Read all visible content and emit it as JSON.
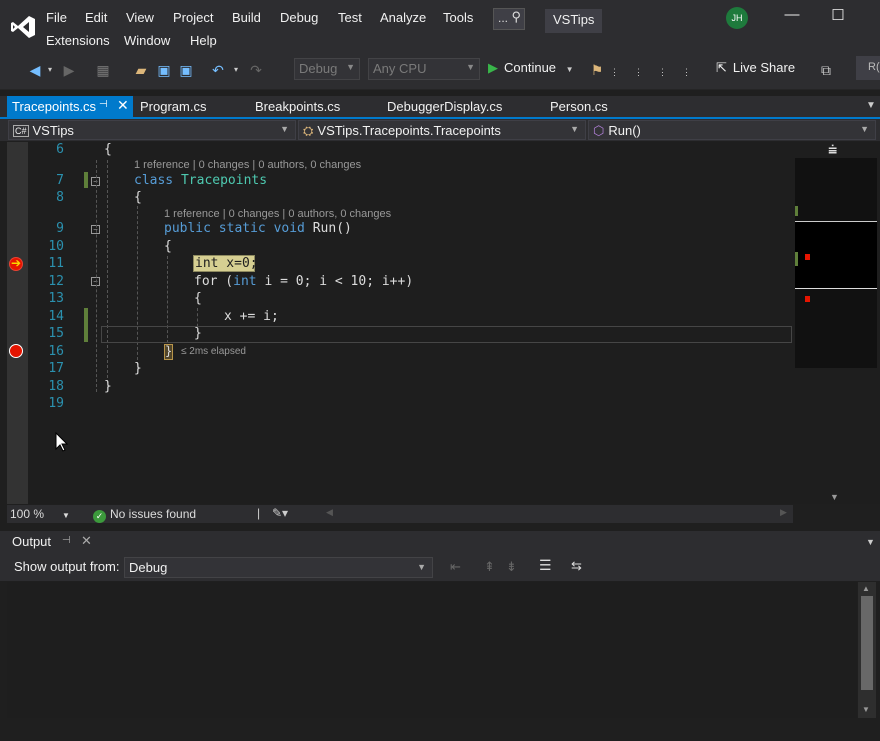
{
  "menu": {
    "row1": [
      "File",
      "Edit",
      "View",
      "Project",
      "Build",
      "Debug",
      "Test",
      "Analyze",
      "Tools"
    ],
    "row2": [
      "Extensions",
      "Window",
      "Help"
    ],
    "search_placeholder": "...",
    "solution_name": "VSTips",
    "user_initials": "JH"
  },
  "toolbar": {
    "config": "Debug",
    "platform": "Any CPU",
    "continue_label": "Continue",
    "live_share_label": "Live Share",
    "r_label": "R("
  },
  "tabs": [
    "Tracepoints.cs",
    "Program.cs",
    "Breakpoints.cs",
    "DebuggerDisplay.cs",
    "Person.cs"
  ],
  "navbar": {
    "project": "VSTips",
    "type": "VSTips.Tracepoints.Tracepoints",
    "member": "Run()"
  },
  "editor": {
    "line_numbers": [
      "6",
      "7",
      "8",
      "9",
      "10",
      "11",
      "12",
      "13",
      "14",
      "15",
      "16",
      "17",
      "18",
      "19"
    ],
    "lens_class": "1 reference | 0 changes | 0 authors, 0 changes",
    "lens_method": "1 reference | 0 changes | 0 authors, 0 changes",
    "elapsed": "≤ 2ms elapsed",
    "code": {
      "l6": "{",
      "l7_kw": "class",
      "l7_name": "Tracepoints",
      "l8": "{",
      "l9_kw": "public static void",
      "l9_rest": "Run()",
      "l10": "{",
      "l11": "int x=0;",
      "l12_for": "for (",
      "l12_int": "int",
      "l12_rest": " i = 0; i < 10; i++)",
      "l13": "{",
      "l14": "x += i;",
      "l15": "}",
      "l16": "}",
      "l17": "}",
      "l18": "}"
    }
  },
  "status": {
    "zoom": "100 %",
    "issues": "No issues found"
  },
  "output": {
    "title": "Output",
    "show_from_label": "Show output from:",
    "source": "Debug"
  },
  "colors": {
    "accent": "#007acc",
    "breakpoint": "#e51400",
    "current_statement": "#d6cf92"
  }
}
